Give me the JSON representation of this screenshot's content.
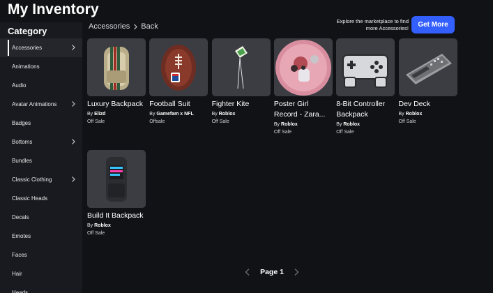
{
  "page": {
    "title": "My Inventory"
  },
  "sidebar": {
    "title": "Category",
    "items": [
      {
        "label": "Accessories",
        "active": true,
        "chevron": true
      },
      {
        "label": "Animations",
        "active": false,
        "chevron": false
      },
      {
        "label": "Audio",
        "active": false,
        "chevron": false
      },
      {
        "label": "Avatar Animations",
        "active": false,
        "chevron": true
      },
      {
        "label": "Badges",
        "active": false,
        "chevron": false
      },
      {
        "label": "Bottoms",
        "active": false,
        "chevron": true
      },
      {
        "label": "Bundles",
        "active": false,
        "chevron": false
      },
      {
        "label": "Classic Clothing",
        "active": false,
        "chevron": true
      },
      {
        "label": "Classic Heads",
        "active": false,
        "chevron": false
      },
      {
        "label": "Decals",
        "active": false,
        "chevron": false
      },
      {
        "label": "Emotes",
        "active": false,
        "chevron": false
      },
      {
        "label": "Faces",
        "active": false,
        "chevron": false
      },
      {
        "label": "Hair",
        "active": false,
        "chevron": false
      },
      {
        "label": "Heads",
        "active": false,
        "chevron": false
      }
    ]
  },
  "breadcrumb": {
    "current": "Accessories",
    "back_label": "Back"
  },
  "promo": {
    "text": "Explore the marketplace to find more Accessories!",
    "button_label": "Get More",
    "button_color": "#335fff"
  },
  "items": [
    {
      "name": "Luxury Backpack",
      "creator_prefix": "By",
      "creator": "Elizd",
      "price": "Off Sale",
      "icon": "backpack-icon"
    },
    {
      "name": "Football Suit",
      "creator_prefix": "By",
      "creator": "Gamefam x NFL",
      "price": "Offsale",
      "icon": "football-icon"
    },
    {
      "name": "Fighter Kite",
      "creator_prefix": "By",
      "creator": "Roblox",
      "price": "Off Sale",
      "icon": "kite-icon"
    },
    {
      "name": "Poster Girl Record - Zara...",
      "creator_prefix": "By",
      "creator": "Roblox",
      "price": "Off Sale",
      "icon": "record-icon"
    },
    {
      "name": "8-Bit Controller Backpack",
      "creator_prefix": "By",
      "creator": "Roblox",
      "price": "Off Sale",
      "icon": "controller-icon"
    },
    {
      "name": "Dev Deck",
      "creator_prefix": "By",
      "creator": "Roblox",
      "price": "Off Sale",
      "icon": "keyboard-icon"
    },
    {
      "name": "Build It Backpack",
      "creator_prefix": "By",
      "creator": "Roblox",
      "price": "Off Sale",
      "icon": "backpack-icon"
    }
  ],
  "pagination": {
    "label": "Page 1"
  },
  "colors": {
    "background": "#111216",
    "sidebar": "#191a1f",
    "card": "#3c3d43",
    "accent": "#335fff"
  }
}
